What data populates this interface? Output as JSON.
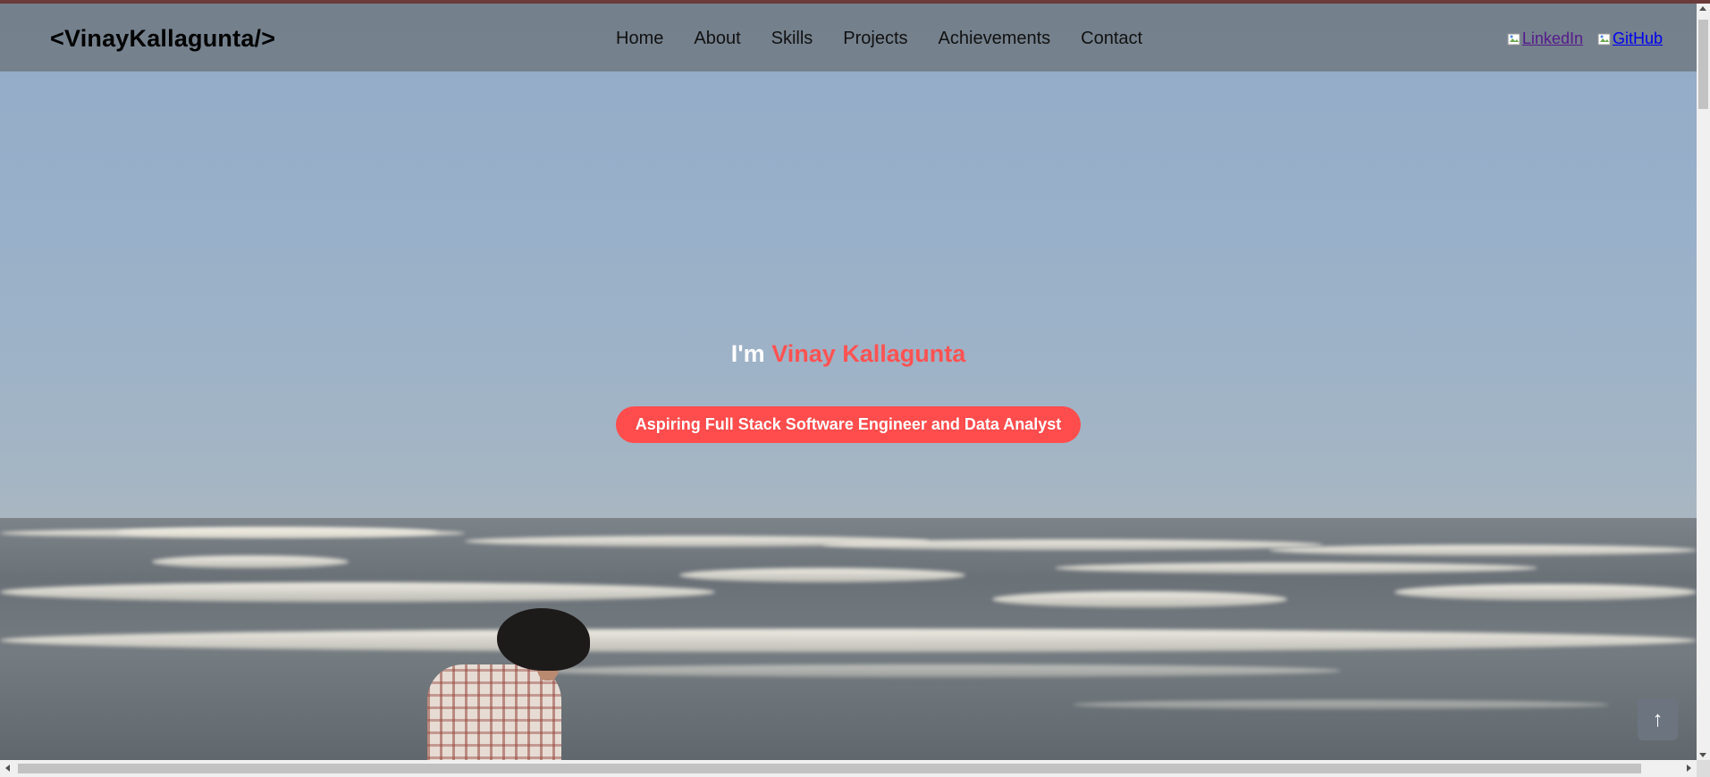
{
  "navbar": {
    "brand": "<VinayKallagunta/>",
    "links": [
      "Home",
      "About",
      "Skills",
      "Projects",
      "Achievements",
      "Contact"
    ],
    "social": {
      "linkedin_label": "LinkedIn",
      "github_label": "GitHub"
    }
  },
  "hero": {
    "greeting": "I'm",
    "name": "Vinay Kallagunta",
    "tagline": "Aspiring Full Stack Software Engineer and Data Analyst",
    "background_image": "beach-waves-photo"
  },
  "back_to_top": {
    "icon": "arrow-up-icon",
    "glyph": "↑"
  },
  "colors": {
    "accent": "#ff4c4c",
    "navbar_bg": "#6e7880",
    "button_bg": "#6c7480"
  }
}
